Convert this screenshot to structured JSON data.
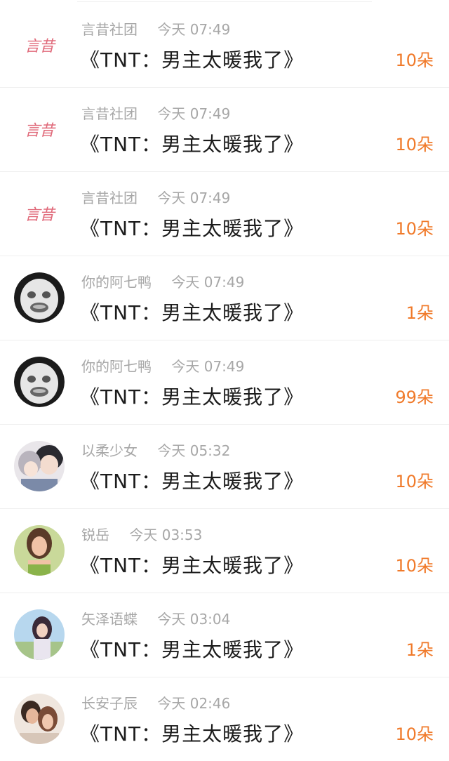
{
  "items": [
    {
      "avatar": "logo",
      "name": "言昔社团",
      "time": "今天 07:49",
      "title": "《TNT：男主太暖我了》",
      "count": "10朵",
      "logo_text": "言昔"
    },
    {
      "avatar": "logo",
      "name": "言昔社团",
      "time": "今天 07:49",
      "title": "《TNT：男主太暖我了》",
      "count": "10朵",
      "logo_text": "言昔"
    },
    {
      "avatar": "logo",
      "name": "言昔社团",
      "time": "今天 07:49",
      "title": "《TNT：男主太暖我了》",
      "count": "10朵",
      "logo_text": "言昔"
    },
    {
      "avatar": "meme",
      "name": "你的阿七鸭",
      "time": "今天 07:49",
      "title": "《TNT：男主太暖我了》",
      "count": "1朵"
    },
    {
      "avatar": "meme",
      "name": "你的阿七鸭",
      "time": "今天 07:49",
      "title": "《TNT：男主太暖我了》",
      "count": "99朵"
    },
    {
      "avatar": "anime",
      "name": "以柔少女",
      "time": "今天 05:32",
      "title": "《TNT：男主太暖我了》",
      "count": "10朵"
    },
    {
      "avatar": "photo-green",
      "name": "锐岳",
      "time": "今天 03:53",
      "title": "《TNT：男主太暖我了》",
      "count": "10朵"
    },
    {
      "avatar": "photo-sky",
      "name": "矢泽语蝶",
      "time": "今天 03:04",
      "title": "《TNT：男主太暖我了》",
      "count": "1朵"
    },
    {
      "avatar": "photo-couple",
      "name": "长安子辰",
      "time": "今天 02:46",
      "title": "《TNT：男主太暖我了》",
      "count": "10朵"
    }
  ],
  "colors": {
    "name": "#a7a7a7",
    "title": "#1c1c1c",
    "count": "#f07a2a"
  }
}
